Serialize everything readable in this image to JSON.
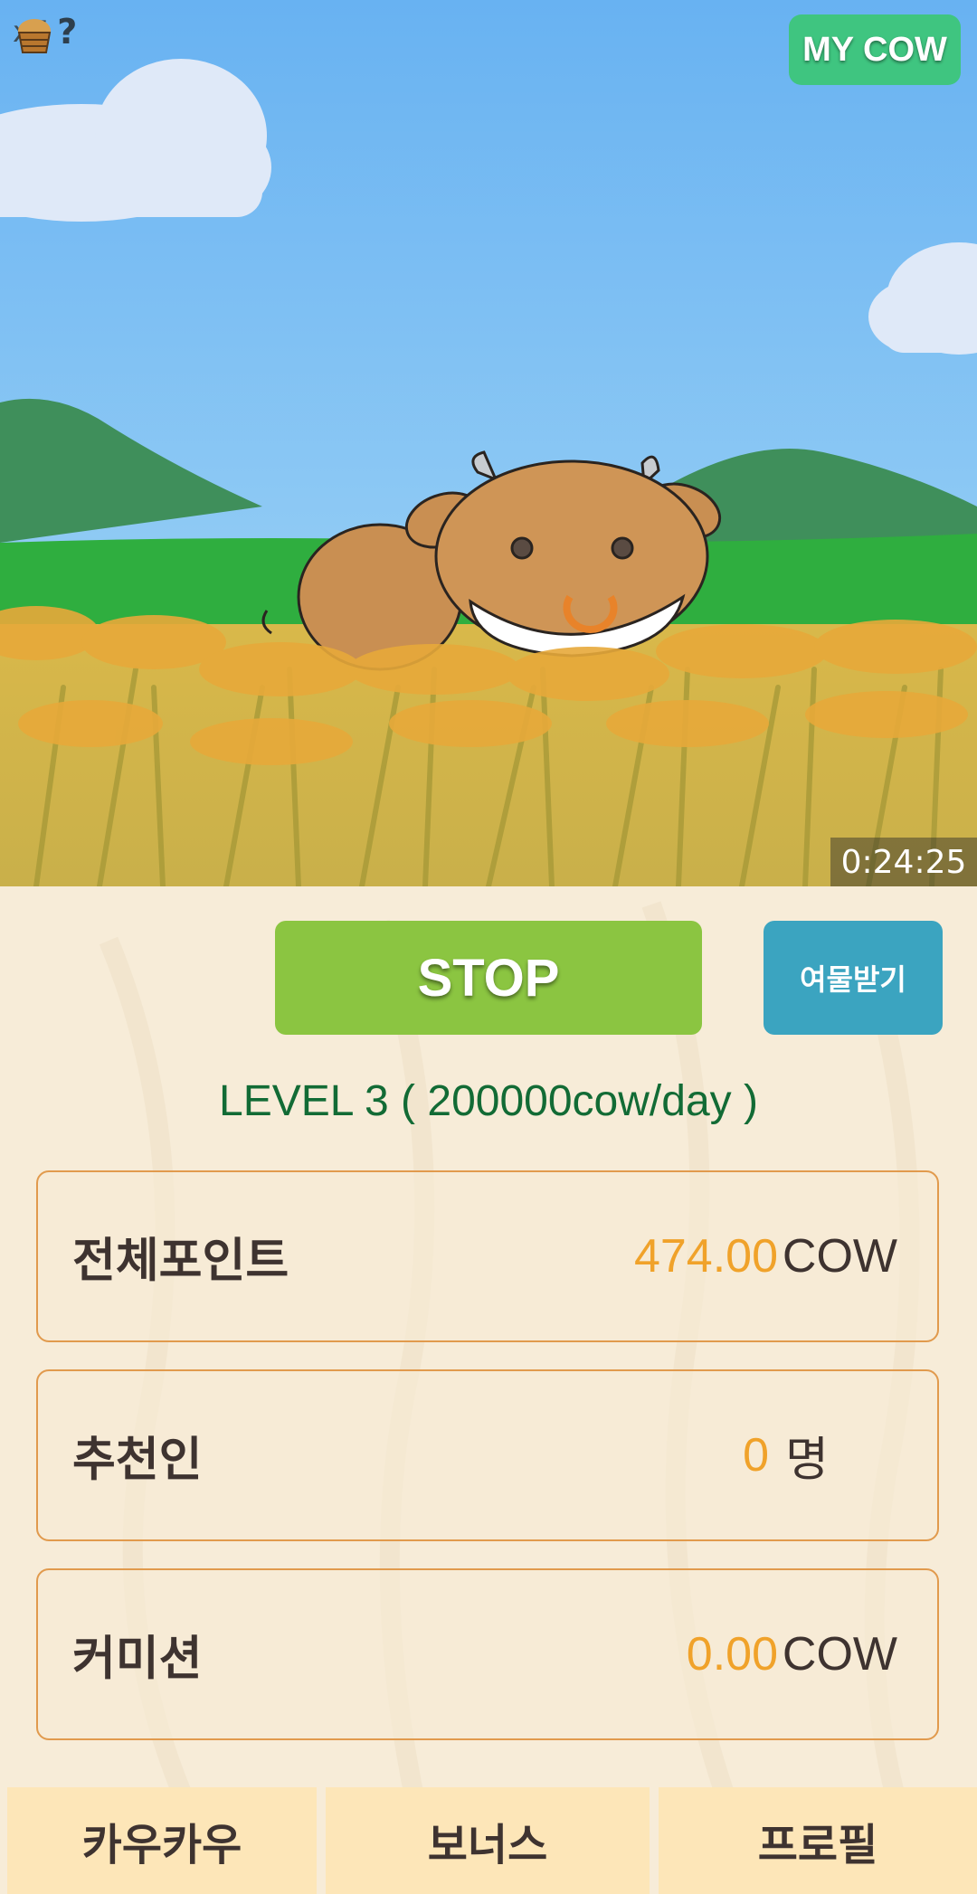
{
  "hud": {
    "feed_icon": "feed-bucket-icon",
    "feed_count": "x7",
    "help_icon": "question-mark-icon",
    "help_symbol": "?"
  },
  "header": {
    "mycow_label": "MY COW"
  },
  "timer": "0:24:25",
  "actions": {
    "stop_label": "STOP",
    "reward_label": "여물받기"
  },
  "level_text": "LEVEL  3 ( 200000cow/day )",
  "stats": [
    {
      "label": "전체포인트",
      "value": "474.00",
      "unit": "COW"
    },
    {
      "label": "추천인",
      "value": "0",
      "unit": "명"
    },
    {
      "label": "커미션",
      "value": "0.00",
      "unit": "COW"
    }
  ],
  "tabs": [
    {
      "label": "카우카우"
    },
    {
      "label": "보너스"
    },
    {
      "label": "프로필"
    }
  ],
  "colors": {
    "sky_top": "#6fb8f0",
    "stop_green": "#8bc541",
    "mycow_green": "#3fc580",
    "reward_blue": "#3ba4c0",
    "level_green": "#126b35",
    "value_orange": "#f0a22a",
    "card_border": "#e19a4d",
    "tab_bg": "#fde6b8"
  }
}
